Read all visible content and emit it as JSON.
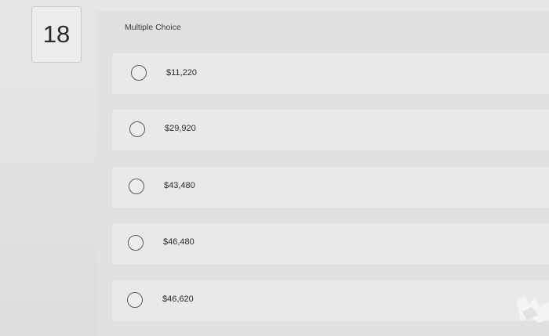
{
  "question": {
    "number": "18",
    "type_label": "Multiple Choice"
  },
  "options": [
    {
      "label": "$11,220",
      "selected": false
    },
    {
      "label": "$29,920",
      "selected": false
    },
    {
      "label": "$43,480",
      "selected": false
    },
    {
      "label": "$46,480",
      "selected": false
    },
    {
      "label": "$46,620",
      "selected": false
    }
  ],
  "icons": {
    "radio": "radio-button-unselected-icon"
  }
}
